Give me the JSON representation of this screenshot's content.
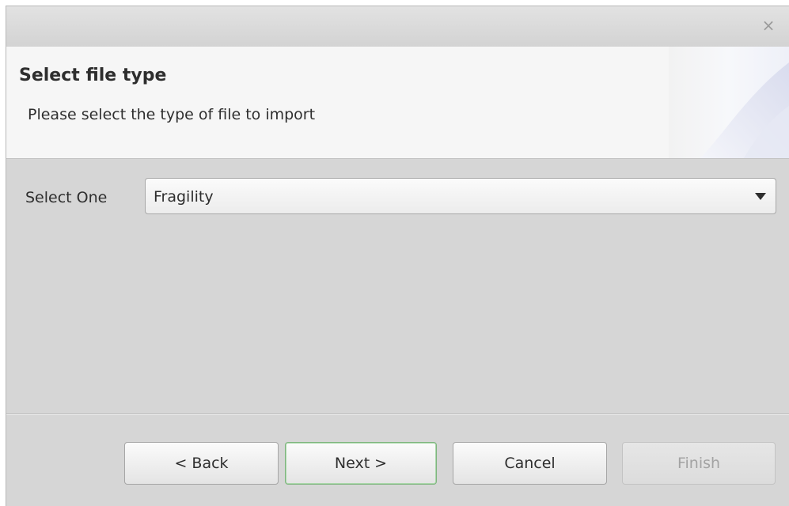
{
  "window": {
    "close_glyph": "×"
  },
  "header": {
    "title": "Select file type",
    "description": "Please select the type of file to import"
  },
  "form": {
    "select_label": "Select One",
    "selected_value": "Fragility"
  },
  "buttons": {
    "back": "< Back",
    "next": "Next >",
    "cancel": "Cancel",
    "finish": "Finish"
  },
  "icons": {
    "close": "close-icon",
    "dropdown": "chevron-down-icon"
  }
}
